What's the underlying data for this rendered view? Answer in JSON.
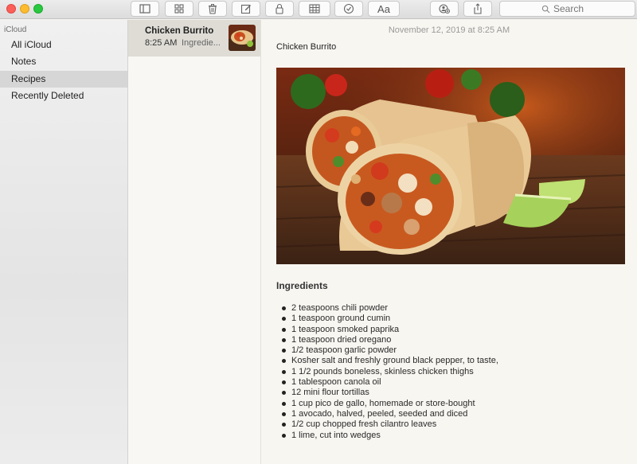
{
  "window": {
    "toolbar": {
      "buttons": [
        {
          "id": "sidebar-toggle",
          "icon": "sidebar-icon"
        },
        {
          "id": "gallery-view",
          "icon": "grid-icon"
        },
        {
          "id": "delete",
          "icon": "trash-icon"
        },
        {
          "id": "compose",
          "icon": "compose-icon"
        },
        {
          "id": "lock",
          "icon": "lock-icon"
        },
        {
          "id": "table",
          "icon": "table-icon"
        },
        {
          "id": "checklist",
          "icon": "checkmark-circle-icon"
        },
        {
          "id": "format",
          "label": "Aa"
        },
        {
          "id": "add-people",
          "icon": "add-people-icon"
        },
        {
          "id": "share",
          "icon": "share-icon"
        }
      ],
      "search_placeholder": "Search"
    }
  },
  "sidebar": {
    "header": "iCloud",
    "items": [
      {
        "label": "All iCloud",
        "selected": false
      },
      {
        "label": "Notes",
        "selected": false
      },
      {
        "label": "Recipes",
        "selected": true
      },
      {
        "label": "Recently Deleted",
        "selected": false
      }
    ]
  },
  "note_list": {
    "notes": [
      {
        "title": "Chicken Burrito",
        "time": "8:25 AM",
        "preview": "Ingredie...",
        "thumbnail": "burrito-thumbnail"
      }
    ]
  },
  "editor": {
    "date": "November 12, 2019 at 8:25 AM",
    "heading": "Chicken Burrito",
    "image": "burrito-photo",
    "ingredients_title": "Ingredients",
    "ingredients": [
      "2 teaspoons chili powder",
      "1 teaspoon ground cumin",
      "1 teaspoon smoked paprika",
      "1 teaspoon dried oregano",
      "1/2 teaspoon garlic powder",
      "Kosher salt and freshly ground black pepper, to taste,",
      "1 1/2 pounds boneless, skinless chicken thighs",
      "1 tablespoon canola oil",
      "12 mini flour tortillas",
      "1 cup pico de gallo, homemade or store-bought",
      "1 avocado, halved, peeled, seeded and diced",
      "1/2 cup chopped fresh cilantro leaves",
      "1 lime, cut into wedges"
    ]
  },
  "colors": {
    "close": "#fc5f57",
    "minimize": "#fdbc2e",
    "zoom": "#29c840",
    "selection": "#d6d6d6",
    "note_selection": "#dedcd5",
    "paper": "#f8f6f1"
  }
}
